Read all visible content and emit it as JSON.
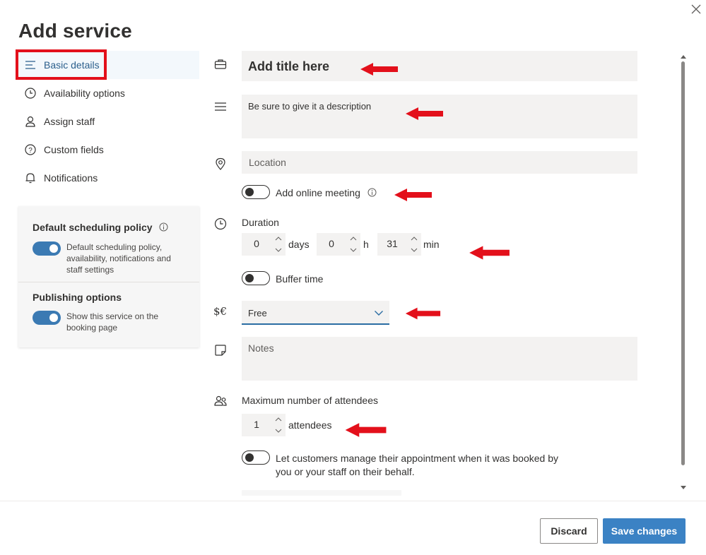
{
  "dialog": {
    "title": "Add service",
    "close_icon": "close-icon"
  },
  "nav": {
    "items": [
      {
        "label": "Basic details",
        "icon": "lines-icon",
        "active": true
      },
      {
        "label": "Availability options",
        "icon": "clock-icon"
      },
      {
        "label": "Assign staff",
        "icon": "person-icon"
      },
      {
        "label": "Custom fields",
        "icon": "question-icon"
      },
      {
        "label": "Notifications",
        "icon": "bell-icon"
      }
    ]
  },
  "policy": {
    "default_heading": "Default scheduling policy",
    "default_enabled": true,
    "default_desc": "Default scheduling policy, availability, notifications and staff settings",
    "publishing_heading": "Publishing options",
    "publishing_enabled": true,
    "publishing_desc": "Show this service on the booking page"
  },
  "form": {
    "title_placeholder": "Add title here",
    "description_placeholder": "Be sure to give it a description",
    "location_placeholder": "Location",
    "online_meeting_label": "Add online meeting",
    "online_meeting_enabled": false,
    "duration_label": "Duration",
    "days_value": "0",
    "days_unit": "days",
    "hours_value": "0",
    "hours_unit": "h",
    "minutes_value": "31",
    "minutes_unit": "min",
    "buffer_label": "Buffer time",
    "buffer_enabled": false,
    "price_value": "Free",
    "notes_placeholder": "Notes",
    "max_attendees_label": "Maximum number of attendees",
    "attendees_value": "1",
    "attendees_unit": "attendees",
    "manage_label_line1": "Let customers manage their appointment when it was booked by",
    "manage_label_line2": "you or your staff on their behalf.",
    "manage_enabled": false,
    "currency_glyph": "$€"
  },
  "footer": {
    "discard_label": "Discard",
    "save_label": "Save changes"
  },
  "colors": {
    "accent": "#3b82c4",
    "annotation_red": "#e3101b",
    "nav_active_text": "#2b5f8c"
  }
}
